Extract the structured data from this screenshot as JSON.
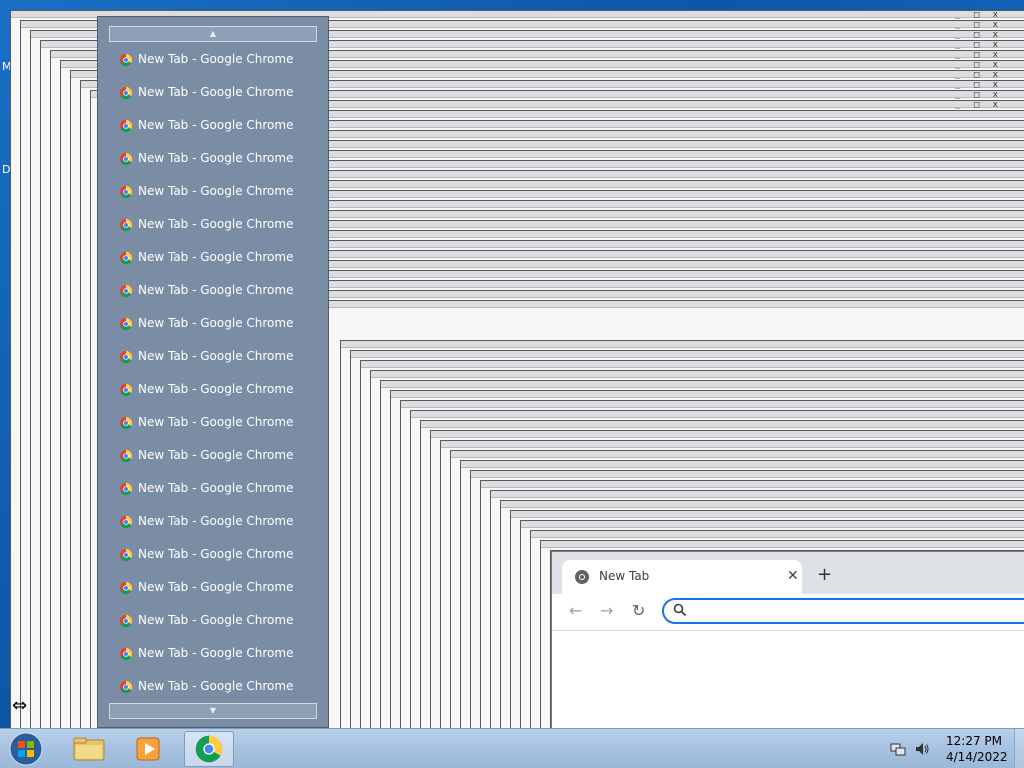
{
  "desktop": {
    "edge_letters": [
      "M",
      "D"
    ]
  },
  "window_list": {
    "scroll_up_glyph": "▲",
    "scroll_down_glyph": "▼",
    "items": [
      {
        "label": "New Tab - Google Chrome",
        "icon": "chrome-icon"
      },
      {
        "label": "New Tab - Google Chrome",
        "icon": "chrome-icon"
      },
      {
        "label": "New Tab - Google Chrome",
        "icon": "chrome-icon"
      },
      {
        "label": "New Tab - Google Chrome",
        "icon": "chrome-icon"
      },
      {
        "label": "New Tab - Google Chrome",
        "icon": "chrome-icon"
      },
      {
        "label": "New Tab - Google Chrome",
        "icon": "chrome-icon"
      },
      {
        "label": "New Tab - Google Chrome",
        "icon": "chrome-icon"
      },
      {
        "label": "New Tab - Google Chrome",
        "icon": "chrome-icon"
      },
      {
        "label": "New Tab - Google Chrome",
        "icon": "chrome-icon"
      },
      {
        "label": "New Tab - Google Chrome",
        "icon": "chrome-icon"
      },
      {
        "label": "New Tab - Google Chrome",
        "icon": "chrome-icon"
      },
      {
        "label": "New Tab - Google Chrome",
        "icon": "chrome-icon"
      },
      {
        "label": "New Tab - Google Chrome",
        "icon": "chrome-icon"
      },
      {
        "label": "New Tab - Google Chrome",
        "icon": "chrome-icon"
      },
      {
        "label": "New Tab - Google Chrome",
        "icon": "chrome-icon"
      },
      {
        "label": "New Tab - Google Chrome",
        "icon": "chrome-icon"
      },
      {
        "label": "New Tab - Google Chrome",
        "icon": "chrome-icon"
      },
      {
        "label": "New Tab - Google Chrome",
        "icon": "chrome-icon"
      },
      {
        "label": "New Tab - Google Chrome",
        "icon": "chrome-icon"
      },
      {
        "label": "New Tab - Google Chrome",
        "icon": "chrome-icon"
      }
    ]
  },
  "chrome": {
    "tab_title": "New Tab",
    "close_glyph": "✕",
    "new_tab_glyph": "+",
    "back_glyph": "←",
    "forward_glyph": "→",
    "reload_glyph": "↻",
    "omnibox_value": "",
    "omnibox_accent": "#1a73e8"
  },
  "taskbar": {
    "pinned": [
      {
        "name": "windows-explorer",
        "icon": "folder-icon"
      },
      {
        "name": "media-player",
        "icon": "media-player-icon"
      },
      {
        "name": "google-chrome",
        "icon": "chrome-icon",
        "active": true
      }
    ],
    "clock_time": "12:27 PM",
    "clock_date": "4/14/2022"
  },
  "cursor": {
    "glyph": "⇔"
  },
  "colors": {
    "desktop_blue": "#0d56a8",
    "popup_bg": "#7a8da5",
    "taskbar": "#a6c2e0"
  }
}
